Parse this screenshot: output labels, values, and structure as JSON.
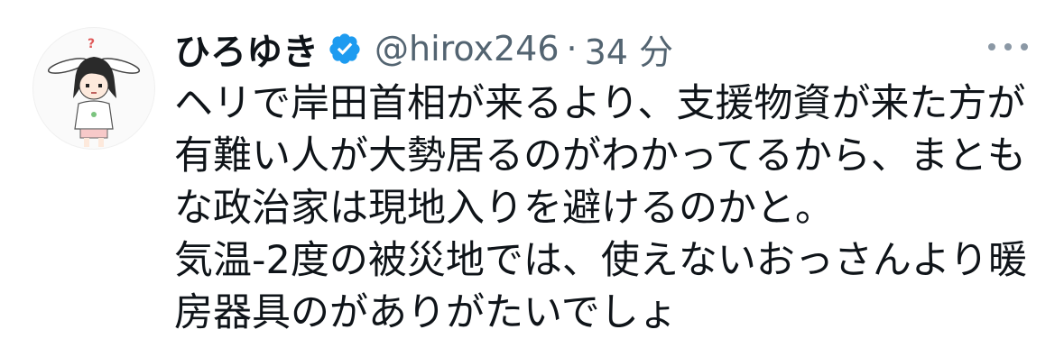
{
  "tweet": {
    "author": {
      "display_name": "ひろゆき",
      "handle": "@hirox246",
      "verified": true,
      "avatar_icon": "avatar-illustration"
    },
    "separator": "·",
    "time": "34 分",
    "more_icon": "more-horizontal-icon",
    "text_lines": [
      "ヘリで岸田首相が来るより、支援物資が来た方が",
      "有難い人が大勢居るのがわかってるから、まとも",
      "な政治家は現地入りを避けるのかと。",
      "気温-2度の被災地では、使えないおっさんより暖",
      "房器具のがありがたいでしょ"
    ]
  },
  "colors": {
    "text_primary": "#0f1419",
    "text_secondary": "#536471",
    "verified_blue": "#1d9bf0"
  }
}
